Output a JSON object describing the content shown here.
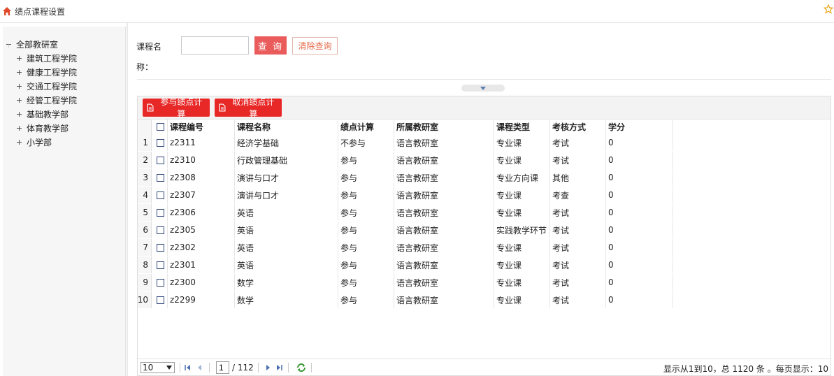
{
  "header": {
    "title": "绩点课程设置"
  },
  "tree": {
    "root": "全部教研室",
    "items": [
      "建筑工程学院",
      "健康工程学院",
      "交通工程学院",
      "经管工程学院",
      "基础教学部",
      "体育教学部",
      "小学部"
    ]
  },
  "search": {
    "label_line1": "课程名",
    "label_line2": "称：",
    "input_value": "",
    "query_label": "查 询",
    "clear_label": "清除查询"
  },
  "toolbar": {
    "join_label": "参与绩点计算",
    "cancel_label": "取消绩点计算"
  },
  "table": {
    "columns": [
      "课程编号",
      "课程名称",
      "绩点计算",
      "所属教研室",
      "课程类型",
      "考核方式",
      "学分"
    ],
    "rows": [
      {
        "no": "1",
        "code": "z2311",
        "name": "经济学基础",
        "gpa": "不参与",
        "dept": "语言教研室",
        "type": "专业课",
        "exam": "考试",
        "credit": "0"
      },
      {
        "no": "2",
        "code": "z2310",
        "name": "行政管理基础",
        "gpa": "参与",
        "dept": "语言教研室",
        "type": "专业课",
        "exam": "考试",
        "credit": "0"
      },
      {
        "no": "3",
        "code": "z2308",
        "name": "演讲与口才",
        "gpa": "参与",
        "dept": "语言教研室",
        "type": "专业方向课",
        "exam": "其他",
        "credit": "0"
      },
      {
        "no": "4",
        "code": "z2307",
        "name": "演讲与口才",
        "gpa": "参与",
        "dept": "语言教研室",
        "type": "专业课",
        "exam": "考查",
        "credit": "0"
      },
      {
        "no": "5",
        "code": "z2306",
        "name": "英语",
        "gpa": "参与",
        "dept": "语言教研室",
        "type": "专业课",
        "exam": "考试",
        "credit": "0"
      },
      {
        "no": "6",
        "code": "z2305",
        "name": "英语",
        "gpa": "参与",
        "dept": "语言教研室",
        "type": "实践教学环节",
        "exam": "考试",
        "credit": "0"
      },
      {
        "no": "7",
        "code": "z2302",
        "name": "英语",
        "gpa": "参与",
        "dept": "语言教研室",
        "type": "专业课",
        "exam": "考试",
        "credit": "0"
      },
      {
        "no": "8",
        "code": "z2301",
        "name": "英语",
        "gpa": "参与",
        "dept": "语言教研室",
        "type": "专业课",
        "exam": "考试",
        "credit": "0"
      },
      {
        "no": "9",
        "code": "z2300",
        "name": "数学",
        "gpa": "参与",
        "dept": "语言教研室",
        "type": "专业课",
        "exam": "考试",
        "credit": "0"
      },
      {
        "no": "10",
        "code": "z2299",
        "name": "数学",
        "gpa": "参与",
        "dept": "语言教研室",
        "type": "专业课",
        "exam": "考试",
        "credit": "0"
      }
    ]
  },
  "pager": {
    "page_size": "10",
    "current_page": "1",
    "total_pages": "/ 112",
    "info": "显示从1到10，总 1120 条 。每页显示：10"
  },
  "colors": {
    "query_button": "#ea5c5c",
    "toolbar_button": "#e82727",
    "clear_text": "#e36a48"
  }
}
